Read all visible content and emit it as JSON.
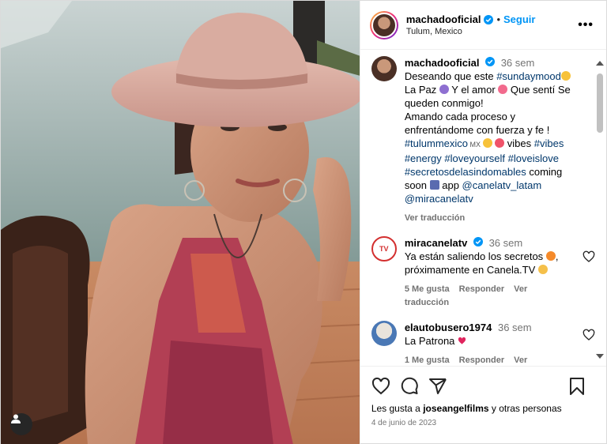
{
  "header": {
    "username": "machadooficial",
    "separator": "•",
    "follow_label": "Seguir",
    "location": "Tulum, Mexico",
    "more_label": "•••"
  },
  "caption": {
    "username": "machadooficial",
    "time": "36 sem",
    "text_1": "Deseando que este ",
    "tag_sundaymood": "#sundaymood",
    "text_2": "La Paz ",
    "text_3": " Y el amor ",
    "text_4": " Que sentí Se queden conmigo!",
    "text_5": "Amando cada proceso y enfrentándome con fuerza y fe !",
    "tag_tulum": "#tulummexico",
    "mx": " MX ",
    "text_6": " vibes ",
    "tag_vibes": "#vibes",
    "tag_energy": "#energy",
    "tag_loveyourself": "#loveyourself",
    "tag_loveislove": "#loveislove",
    "tag_secretos": "#secretosdelasindomables",
    "text_7": " coming soon ",
    "text_8": " app ",
    "mention_canela": "@canelatv_latam",
    "mention_miracanela": "@miracanelatv",
    "translate": "Ver traducción"
  },
  "comments": [
    {
      "username": "miracanelatv",
      "time": "36 sem",
      "text": "Ya están saliendo los secretos",
      "text_2": ", próximamente en Canela.TV",
      "likes": "5 Me gusta",
      "reply": "Responder",
      "translate": "Ver traducción",
      "avatar_text": "TV"
    },
    {
      "username": "elautobusero1974",
      "time": "36 sem",
      "text": "La Patrona",
      "likes": "1 Me gusta",
      "reply": "Responder",
      "translate": "Ver traducción"
    }
  ],
  "footer": {
    "likes_prefix": "Les gusta a ",
    "likes_user": "joseangelfilms",
    "likes_suffix": " y otras personas",
    "date": "4 de junio de 2023"
  },
  "colors": {
    "accent": "#0095f6",
    "hashtag": "#00376b",
    "muted": "#737373"
  }
}
